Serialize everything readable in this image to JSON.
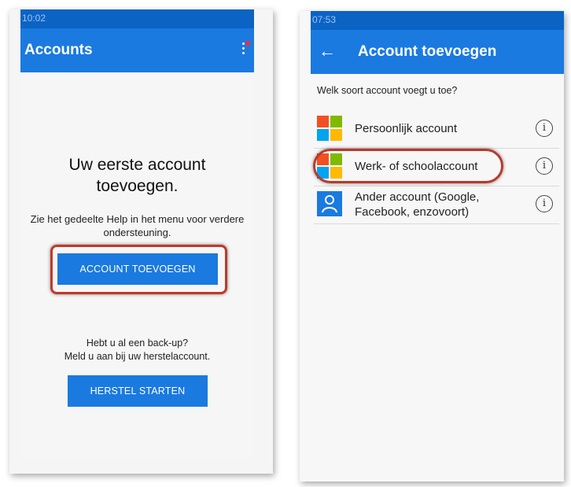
{
  "screen1": {
    "status_time": "10:02",
    "app_title": "Accounts",
    "heading": "Uw eerste account toevoegen.",
    "help_text": "Zie het gedeelte Help in het menu voor verdere ondersteuning.",
    "add_button": "ACCOUNT TOEVOEGEN",
    "backup_question": "Hebt u al een back-up?",
    "backup_instruction": "Meld u aan bij uw herstelaccount.",
    "restore_button": "HERSTEL STARTEN"
  },
  "screen2": {
    "status_time": "07:53",
    "app_title": "Account toevoegen",
    "question": "Welk soort account voegt u toe?",
    "options": [
      {
        "label": "Persoonlijk account",
        "icon": "microsoft-logo-icon"
      },
      {
        "label": "Werk- of schoolaccount",
        "icon": "microsoft-logo-icon"
      },
      {
        "label_line1": "Ander account (Google,",
        "label_line2": "Facebook, enzovoort)",
        "icon": "person-icon"
      }
    ],
    "info_glyph": "i"
  },
  "colors": {
    "appbar": "#1a7ae0",
    "highlight": "#c0392b",
    "ms_red": "#f25022",
    "ms_green": "#7fba00",
    "ms_blue": "#00a4ef",
    "ms_yellow": "#ffb900"
  }
}
